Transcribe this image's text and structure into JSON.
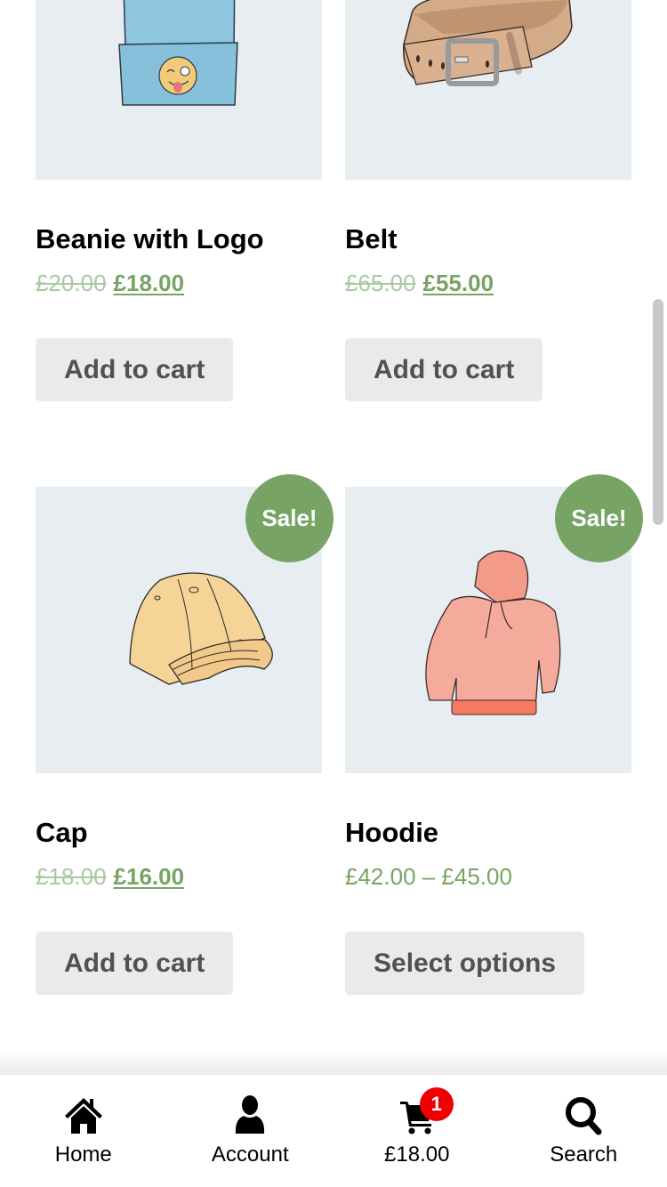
{
  "products": [
    {
      "name": "Beanie with Logo",
      "regular_price": "£20.00",
      "sale_price": "£18.00",
      "button": "Add to cart",
      "image": "beanie-image",
      "on_sale": false
    },
    {
      "name": "Belt",
      "regular_price": "£65.00",
      "sale_price": "£55.00",
      "button": "Add to cart",
      "image": "belt-image",
      "on_sale": false
    },
    {
      "name": "Cap",
      "regular_price": "£18.00",
      "sale_price": "£16.00",
      "button": "Add to cart",
      "image": "cap-image",
      "on_sale": true,
      "sale_badge": "Sale!"
    },
    {
      "name": "Hoodie",
      "price_range": "£42.00 – £45.00",
      "button": "Select options",
      "image": "hoodie-image",
      "on_sale": true,
      "sale_badge": "Sale!"
    }
  ],
  "bottom_nav": {
    "home": {
      "label": "Home",
      "icon": "home-icon"
    },
    "account": {
      "label": "Account",
      "icon": "user-icon"
    },
    "cart": {
      "label": "£18.00",
      "icon": "cart-icon",
      "count": "1"
    },
    "search": {
      "label": "Search",
      "icon": "search-icon"
    }
  },
  "colors": {
    "accent": "#77a464",
    "strike_price": "#a8c9a2",
    "button_bg": "#eae9eb",
    "button_text": "#515151",
    "image_bg": "#e8edf2",
    "badge": "#f00000"
  }
}
